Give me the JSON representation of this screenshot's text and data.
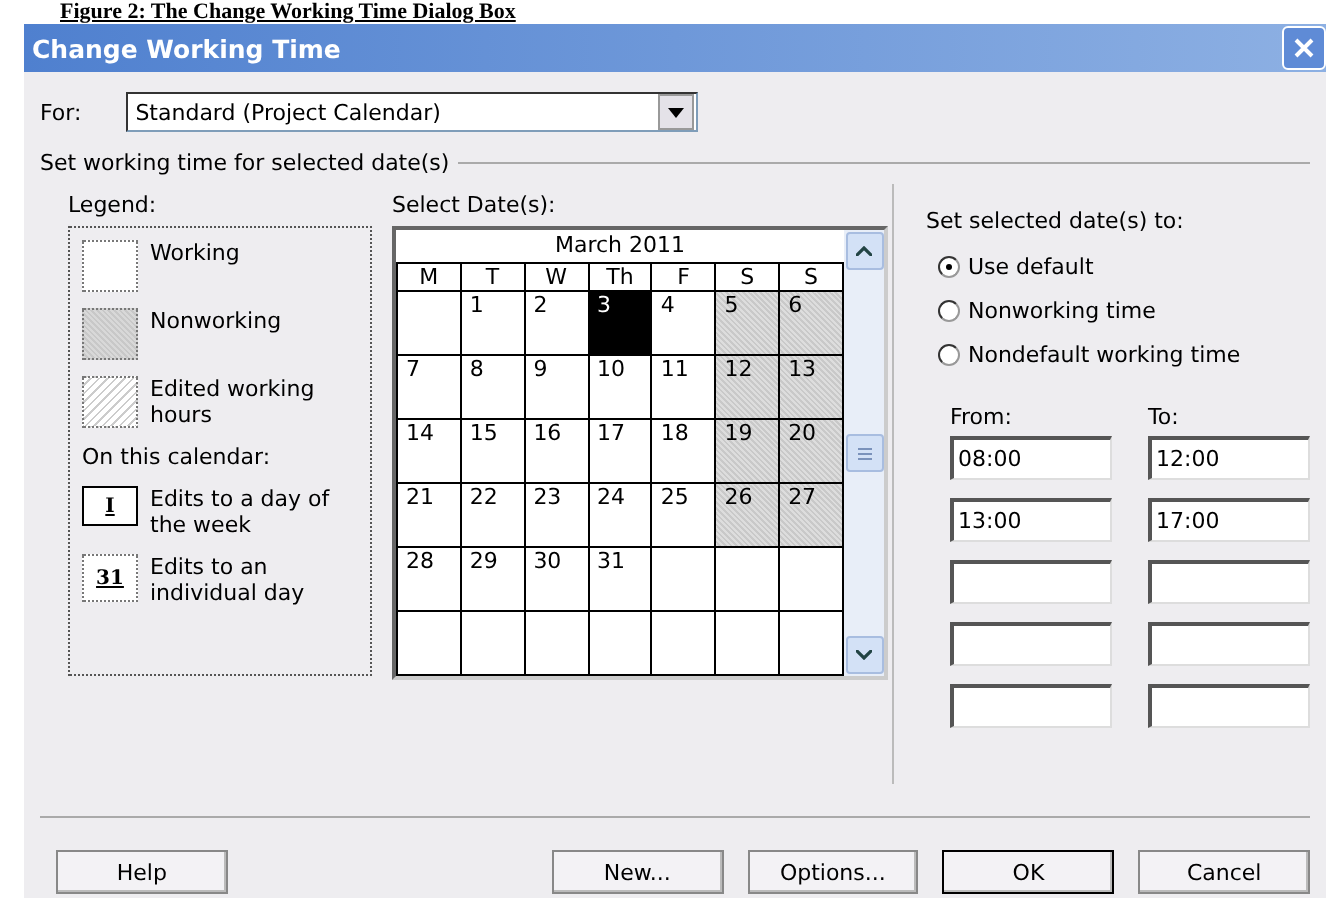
{
  "caption": "Figure 2: The Change Working Time Dialog Box",
  "window": {
    "title": "Change Working Time"
  },
  "for_field": {
    "label": "For:",
    "value": "Standard (Project Calendar)"
  },
  "group_title": "Set working time for selected date(s)",
  "legend": {
    "title": "Legend:",
    "items": [
      {
        "kind": "working",
        "label": "Working"
      },
      {
        "kind": "nonworking",
        "label": "Nonworking"
      },
      {
        "kind": "edited",
        "label": "Edited working hours"
      }
    ],
    "subtitle": "On this calendar:",
    "edits": [
      {
        "kind": "weekday",
        "mark": "I",
        "label": "Edits to a day of the week"
      },
      {
        "kind": "day",
        "mark": "31",
        "label": "Edits to an individual day"
      }
    ]
  },
  "calendar": {
    "label": "Select Date(s):",
    "month": "March 2011",
    "weekdays": [
      "M",
      "T",
      "W",
      "Th",
      "F",
      "S",
      "S"
    ],
    "weeks": [
      [
        {
          "kind": "empty"
        },
        {
          "day": "1",
          "kind": "working"
        },
        {
          "day": "2",
          "kind": "working"
        },
        {
          "day": "3",
          "kind": "selected"
        },
        {
          "day": "4",
          "kind": "working"
        },
        {
          "day": "5",
          "kind": "nonworking"
        },
        {
          "day": "6",
          "kind": "nonworking"
        }
      ],
      [
        {
          "day": "7",
          "kind": "working"
        },
        {
          "day": "8",
          "kind": "working"
        },
        {
          "day": "9",
          "kind": "working"
        },
        {
          "day": "10",
          "kind": "working"
        },
        {
          "day": "11",
          "kind": "working"
        },
        {
          "day": "12",
          "kind": "nonworking"
        },
        {
          "day": "13",
          "kind": "nonworking"
        }
      ],
      [
        {
          "day": "14",
          "kind": "working"
        },
        {
          "day": "15",
          "kind": "working"
        },
        {
          "day": "16",
          "kind": "working"
        },
        {
          "day": "17",
          "kind": "working"
        },
        {
          "day": "18",
          "kind": "working"
        },
        {
          "day": "19",
          "kind": "nonworking"
        },
        {
          "day": "20",
          "kind": "nonworking"
        }
      ],
      [
        {
          "day": "21",
          "kind": "working"
        },
        {
          "day": "22",
          "kind": "working"
        },
        {
          "day": "23",
          "kind": "working"
        },
        {
          "day": "24",
          "kind": "working"
        },
        {
          "day": "25",
          "kind": "working"
        },
        {
          "day": "26",
          "kind": "nonworking"
        },
        {
          "day": "27",
          "kind": "nonworking"
        }
      ],
      [
        {
          "day": "28",
          "kind": "working"
        },
        {
          "day": "29",
          "kind": "working"
        },
        {
          "day": "30",
          "kind": "working"
        },
        {
          "day": "31",
          "kind": "working"
        },
        {
          "kind": "empty"
        },
        {
          "kind": "empty"
        },
        {
          "kind": "empty"
        }
      ],
      [
        {
          "kind": "empty"
        },
        {
          "kind": "empty"
        },
        {
          "kind": "empty"
        },
        {
          "kind": "empty"
        },
        {
          "kind": "empty"
        },
        {
          "kind": "empty"
        },
        {
          "kind": "empty"
        }
      ]
    ]
  },
  "set_to": {
    "title": "Set selected date(s) to:",
    "options": [
      {
        "label": "Use default",
        "selected": true
      },
      {
        "label": "Nonworking time",
        "selected": false
      },
      {
        "label": "Nondefault working time",
        "selected": false
      }
    ],
    "from_label": "From:",
    "to_label": "To:",
    "times": [
      {
        "kind": "filled",
        "from": "08:00",
        "to": "12:00"
      },
      {
        "kind": "filled",
        "from": "13:00",
        "to": "17:00"
      },
      {
        "kind": "blank"
      },
      {
        "kind": "blank"
      },
      {
        "kind": "blank"
      }
    ]
  },
  "buttons": [
    {
      "label": "Help",
      "kind": "left",
      "default": false
    },
    {
      "label": "New...",
      "kind": "right",
      "default": false
    },
    {
      "label": "Options...",
      "kind": "right",
      "default": false
    },
    {
      "label": "OK",
      "kind": "right",
      "default": true
    },
    {
      "label": "Cancel",
      "kind": "right",
      "default": false
    }
  ]
}
